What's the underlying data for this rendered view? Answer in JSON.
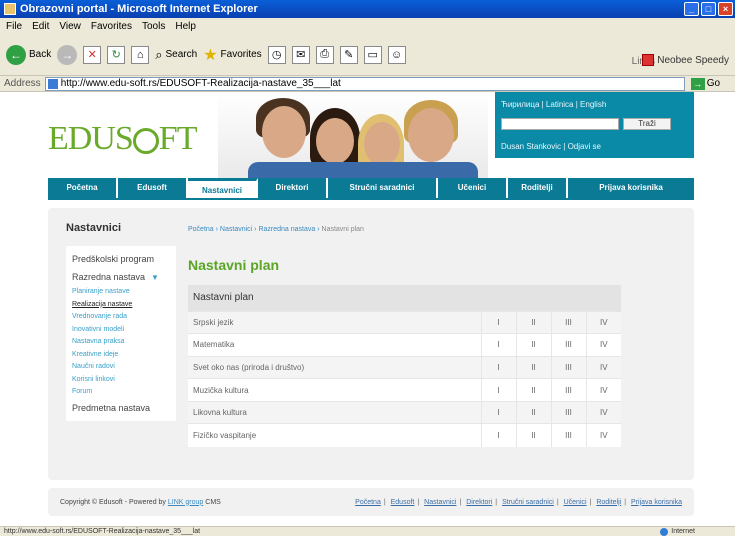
{
  "window": {
    "title": "Obrazovni portal - Microsoft Internet Explorer"
  },
  "menu": [
    "File",
    "Edit",
    "View",
    "Favorites",
    "Tools",
    "Help"
  ],
  "toolbar": {
    "back": "Back",
    "search": "Search",
    "favorites": "Favorites",
    "links": "Links",
    "neobee": "Neobee Speedy"
  },
  "address": {
    "label": "Address",
    "url": "http://www.edu-soft.rs/EDUSOFT-Realizacija-nastave_35___lat",
    "go": "Go"
  },
  "logo": {
    "text_a": "EDUS",
    "text_b": "FT"
  },
  "toppanel": {
    "lang_cyr": "Ћирилица",
    "lang_lat": "Latinica",
    "lang_en": "English",
    "search_btn": "Traži",
    "user": "Dusan Stankovic",
    "logout": "Odjavi se"
  },
  "nav": [
    "Početna",
    "Edusoft",
    "Nastavnici",
    "Direktori",
    "Stručni saradnici",
    "Učenici",
    "Roditelji",
    "Prijava korisnika"
  ],
  "left": {
    "title": "Nastavnici",
    "preschool": "Predškolski program",
    "class": "Razredna nastava",
    "subitems": [
      "Planiranje nastave",
      "Realizacija nastave",
      "Vrednovanje rada",
      "Inovativni modeli",
      "Nastavna praksa",
      "Kreativne ideje",
      "Naučni radovi",
      "Korisni linkovi",
      "Forum"
    ],
    "subject": "Predmetna nastava"
  },
  "breadcrumb": [
    "Početna",
    "Nastavnici",
    "Razredna nastava",
    "Nastavni plan"
  ],
  "page": {
    "title": "Nastavni plan",
    "table_header": "Nastavni plan",
    "rows": [
      {
        "subject": "Srpski jezik",
        "grades": [
          "I",
          "II",
          "III",
          "IV"
        ]
      },
      {
        "subject": "Matematika",
        "grades": [
          "I",
          "II",
          "III",
          "IV"
        ]
      },
      {
        "subject": "Svet oko nas (priroda i društvo)",
        "grades": [
          "I",
          "II",
          "III",
          "IV"
        ]
      },
      {
        "subject": "Muzička kultura",
        "grades": [
          "I",
          "II",
          "III",
          "IV"
        ]
      },
      {
        "subject": "Likovna kultura",
        "grades": [
          "I",
          "II",
          "III",
          "IV"
        ]
      },
      {
        "subject": "Fizičko vaspitanje",
        "grades": [
          "I",
          "II",
          "III",
          "IV"
        ]
      }
    ]
  },
  "footer": {
    "copyright": "Copyright © Edusoft - Powered by",
    "powered": "LINK group",
    "cms": "CMS",
    "links": [
      "Početna",
      "Edusoft",
      "Nastavnici",
      "Direktori",
      "Stručni saradnici",
      "Učenici",
      "Roditelji",
      "Prijava korisnika"
    ]
  },
  "status": {
    "text": "http://www.edu-soft.rs/EDUSOFT-Realizacija-nastave_35___lat",
    "zone": "Internet"
  },
  "colors": {
    "teal": "#0b7a95",
    "green": "#5aa524"
  }
}
